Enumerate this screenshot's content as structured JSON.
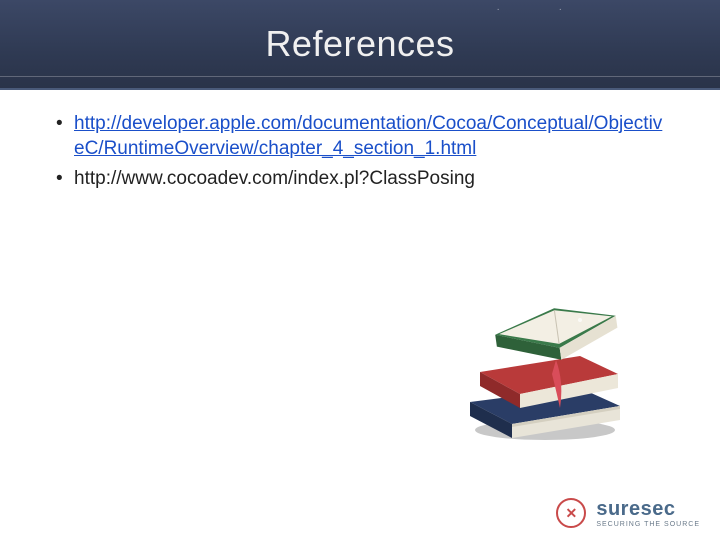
{
  "title": "References",
  "refs": [
    {
      "text": "http://developer.apple.com/documentation/Cocoa/Conceptual/ObjectiveC/RuntimeOverview/chapter_4_section_1.html",
      "link": true
    },
    {
      "text": "http://www.cocoadev.com/index.pl?ClassPosing",
      "link": false
    }
  ],
  "footer": {
    "brand": "suresec",
    "tagline": "SECURING THE SOURCE"
  }
}
